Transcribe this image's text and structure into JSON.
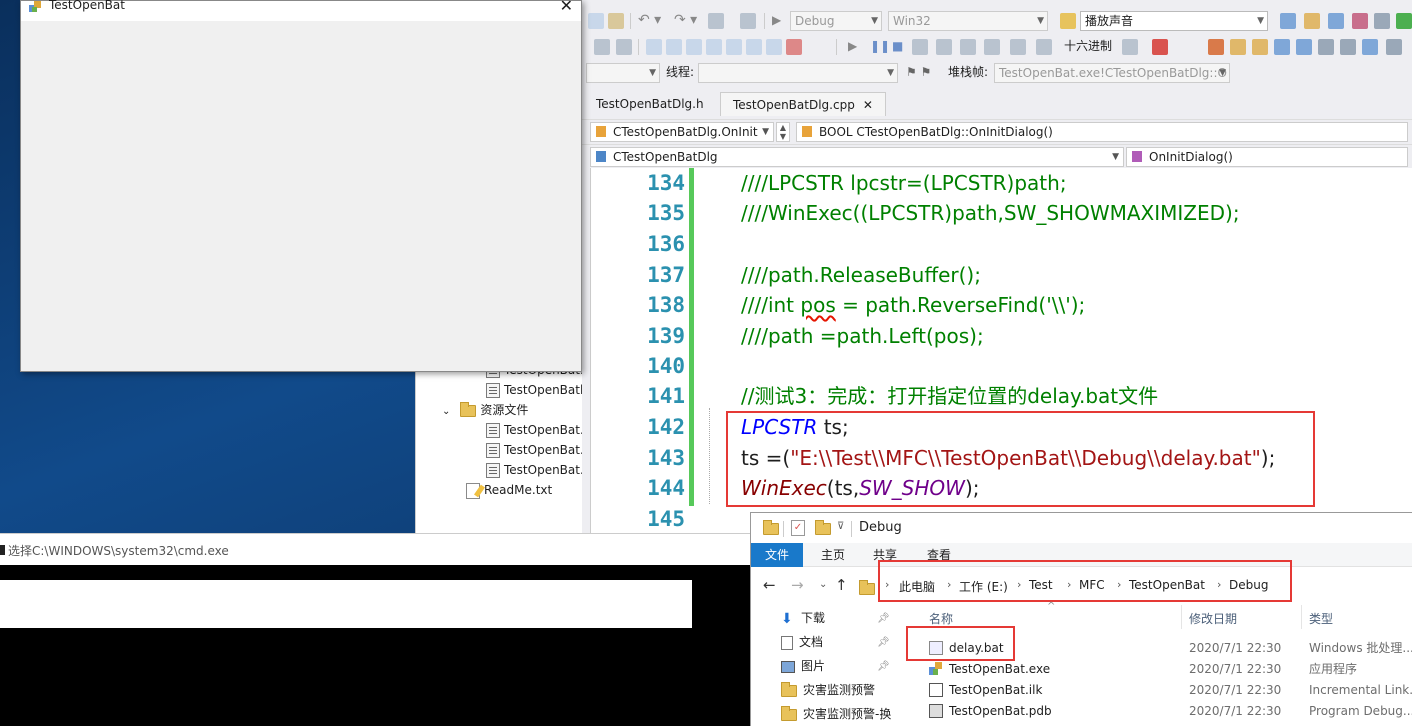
{
  "desktop": {},
  "solution_explorer": {
    "items": [
      {
        "label": "TestOpenBat.",
        "indent": 2,
        "icon": "cpp-file-icon",
        "partial": true
      },
      {
        "label": "TestOpenBatl",
        "indent": 2,
        "icon": "cpp-file-icon"
      },
      {
        "label": "资源文件",
        "indent": 1,
        "icon": "folder-icon",
        "expanded": true
      },
      {
        "label": "TestOpenBat.",
        "indent": 2,
        "icon": "resource-file-icon"
      },
      {
        "label": "TestOpenBat.",
        "indent": 2,
        "icon": "resource-file-icon"
      },
      {
        "label": "TestOpenBat.",
        "indent": 2,
        "icon": "resource-file-icon"
      },
      {
        "label": "ReadMe.txt",
        "indent": 1,
        "icon": "readme-icon"
      }
    ]
  },
  "dialog_window": {
    "title": "TestOpenBat",
    "close_glyph": "✕"
  },
  "vs": {
    "toolbar1": {
      "config_combo": "Debug",
      "platform_combo": "Win32",
      "find_combo": "播放声音"
    },
    "toolbar2": {
      "hex_label": "十六进制"
    },
    "toolbar3": {
      "thread_label": "线程:",
      "stackframe_label": "堆栈帧:",
      "stackframe_value": "TestOpenBat.exe!CTestOpenBatDlg::O"
    },
    "tabs": [
      {
        "label": "TestOpenBatDlg.h",
        "active": false
      },
      {
        "label": "TestOpenBatDlg.cpp",
        "active": true,
        "close_glyph": "✕"
      }
    ],
    "nav1": {
      "left": "CTestOpenBatDlg.OnInit",
      "right": "BOOL CTestOpenBatDlg::OnInitDialog()"
    },
    "nav2": {
      "left": "CTestOpenBatDlg",
      "right": "OnInitDialog()"
    },
    "code": {
      "line_numbers": [
        "134",
        "135",
        "136",
        "137",
        "138",
        "139",
        "140",
        "141",
        "142",
        "143",
        "144",
        "145"
      ],
      "l134": "////LPCSTR lpcstr=(LPCSTR)path;",
      "l135": "////WinExec((LPCSTR)path,SW_SHOWMAXIMIZED);",
      "l137": "////path.ReleaseBuffer();",
      "l138_a": "////int ",
      "l138_b": "pos",
      "l138_c": " = path.ReverseFind('\\\\');",
      "l139": "////path =path.Left(pos);",
      "l141": "//测试3：完成：打开指定位置的delay.bat文件",
      "l142_kw": "LPCSTR",
      "l142_rest": " ts;",
      "l143_a": "ts =(",
      "l143_str": "\"E:\\\\Test\\\\MFC\\\\TestOpenBat\\\\Debug\\\\delay.bat\"",
      "l143_b": ");",
      "l144_fn": "WinExec",
      "l144_a": "(ts,",
      "l144_macro": "SW_SHOW",
      "l144_b": ");"
    }
  },
  "cmd_window": {
    "title": "选择C:\\WINDOWS\\system32\\cmd.exe"
  },
  "explorer": {
    "title": "Debug",
    "ribbon_tabs": [
      "文件",
      "主页",
      "共享",
      "查看"
    ],
    "breadcrumbs": [
      "此电脑",
      "工作 (E:)",
      "Test",
      "MFC",
      "TestOpenBat",
      "Debug"
    ],
    "columns": {
      "name": "名称",
      "date": "修改日期",
      "type": "类型"
    },
    "nav_items": [
      {
        "label": "下载",
        "icon": "download-icon",
        "pinned": true
      },
      {
        "label": "文档",
        "icon": "documents-icon",
        "pinned": true
      },
      {
        "label": "图片",
        "icon": "pictures-icon",
        "pinned": true
      },
      {
        "label": "灾害监测预警",
        "icon": "folder-icon",
        "pinned": false
      },
      {
        "label": "灾害监测预警-换",
        "icon": "folder-icon",
        "pinned": false
      }
    ],
    "files": [
      {
        "name": "delay.bat",
        "date": "2020/7/1 22:30",
        "type": "Windows 批处理...",
        "icon": "bat-file-icon"
      },
      {
        "name": "TestOpenBat.exe",
        "date": "2020/7/1 22:30",
        "type": "应用程序",
        "icon": "exe-file-icon"
      },
      {
        "name": "TestOpenBat.ilk",
        "date": "2020/7/1 22:30",
        "type": "Incremental Link...",
        "icon": "ilk-file-icon"
      },
      {
        "name": "TestOpenBat.pdb",
        "date": "2020/7/1 22:30",
        "type": "Program Debug...",
        "icon": "pdb-file-icon"
      }
    ]
  }
}
